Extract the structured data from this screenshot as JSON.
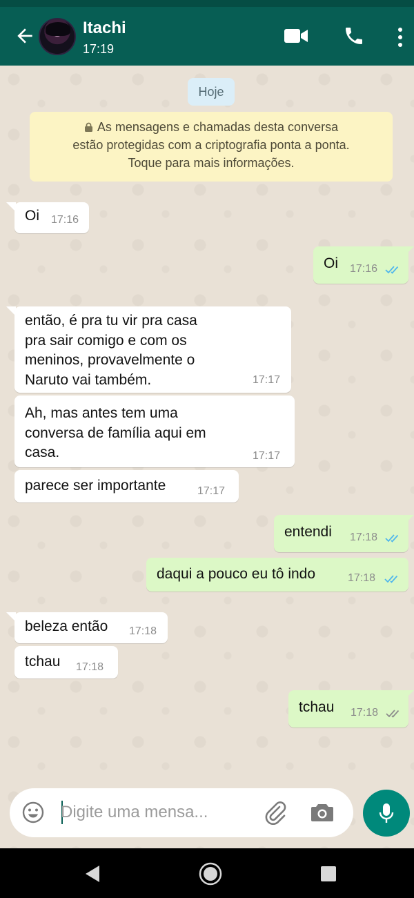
{
  "header": {
    "contact_name": "Itachi",
    "last_seen": "17:19",
    "icons": [
      "back-arrow-icon",
      "video-call-icon",
      "voice-call-icon",
      "more-options-icon"
    ],
    "colors": {
      "bar": "#075e54",
      "status": "#054d44"
    }
  },
  "chat": {
    "date_chip": "Hoje",
    "encryption_notice": {
      "line1": "As mensagens e chamadas desta conversa",
      "line2": "estão protegidas com a criptografia ponta a ponta.",
      "line3": "Toque para mais informações."
    },
    "messages": [
      {
        "direction": "in",
        "lines": [
          "Oi"
        ],
        "time": "17:16"
      },
      {
        "direction": "out",
        "lines": [
          "Oi"
        ],
        "time": "17:16",
        "status": "read"
      },
      {
        "direction": "in",
        "lines": [
          "então, é pra tu vir pra casa",
          "pra sair comigo e com os",
          "meninos, provavelmente o",
          "Naruto vai também."
        ],
        "time": "17:17"
      },
      {
        "direction": "in",
        "lines": [
          "Ah, mas antes tem uma",
          "conversa de família aqui em",
          "casa."
        ],
        "time": "17:17"
      },
      {
        "direction": "in",
        "lines": [
          "parece ser importante"
        ],
        "time": "17:17"
      },
      {
        "direction": "out",
        "lines": [
          "entendi"
        ],
        "time": "17:18",
        "status": "read"
      },
      {
        "direction": "out",
        "lines": [
          "daqui a pouco eu tô indo"
        ],
        "time": "17:18",
        "status": "read"
      },
      {
        "direction": "in",
        "lines": [
          "beleza então"
        ],
        "time": "17:18"
      },
      {
        "direction": "in",
        "lines": [
          "tchau"
        ],
        "time": "17:18"
      },
      {
        "direction": "out",
        "lines": [
          "tchau"
        ],
        "time": "17:18",
        "status": "delivered"
      }
    ],
    "colors": {
      "incoming": "#ffffff",
      "outgoing": "#dcf8c6",
      "read_ticks": "#4fb6ec",
      "delivered_ticks": "#8b8b8b"
    }
  },
  "composer": {
    "placeholder": "Digite uma mensa...",
    "value": "",
    "icons": [
      "emoji-icon",
      "attach-icon",
      "camera-icon",
      "microphone-icon"
    ],
    "mic_color": "#00897b"
  },
  "navbar": {
    "icons": [
      "nav-back-icon",
      "nav-home-icon",
      "nav-recents-icon"
    ]
  }
}
